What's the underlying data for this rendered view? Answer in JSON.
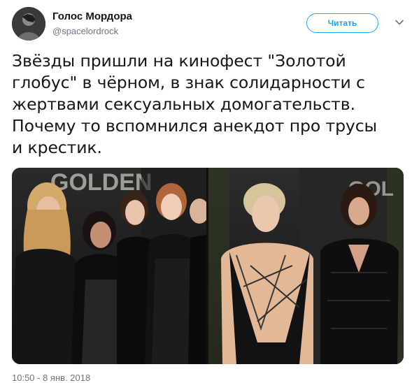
{
  "author": {
    "display_name": "Голос Мордора",
    "handle": "@spacelordrock"
  },
  "actions": {
    "follow_label": "Читать",
    "more_icon": "chevron-down-icon"
  },
  "tweet": {
    "lines": [
      "Звёзды пришли на кинофест \"Золотой",
      "глобус\" в чёрном, в знак солидарности с",
      "жертвами сексуальных домогательств.",
      "Почему то вспомнился анекдот про трусы",
      "и крестик."
    ]
  },
  "media": {
    "left_backdrop_text": "GOLDEN",
    "right_backdrop_text": "GOL"
  },
  "footer": {
    "timestamp": "10:50 - 8 янв. 2018"
  },
  "colors": {
    "accent": "#1da1f2",
    "text": "#14171a",
    "secondary": "#657786"
  }
}
